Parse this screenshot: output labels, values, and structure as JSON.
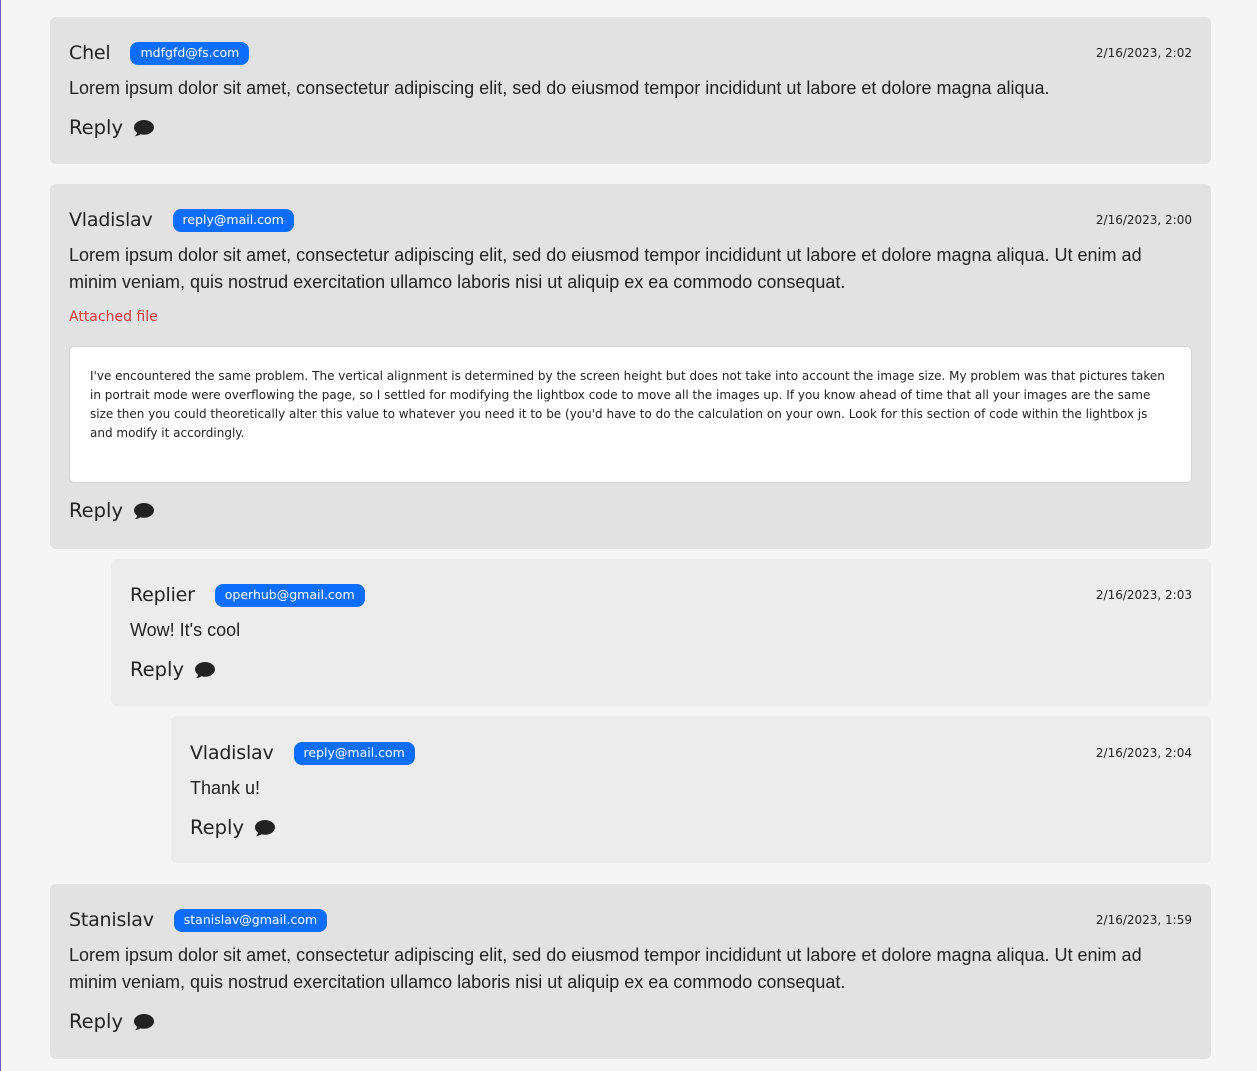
{
  "comments": [
    {
      "author": "Chel",
      "email": "mdfgfd@fs.com",
      "date": "2/16/2023, 2:02",
      "text": "Lorem ipsum dolor sit amet, consectetur adipiscing elit, sed do eiusmod tempor incididunt ut labore et dolore magna aliqua.",
      "reply_label": "Reply"
    },
    {
      "author": "Vladislav",
      "email": "reply@mail.com",
      "date": "2/16/2023, 2:00",
      "text": "Lorem ipsum dolor sit amet, consectetur adipiscing elit, sed do eiusmod tempor incididunt ut labore et dolore magna aliqua. Ut enim ad minim veniam, quis nostrud exercitation ullamco laboris nisi ut aliquip ex ea commodo consequat.",
      "attachment_label": "Attached file",
      "attachment_text": "I've encountered the same problem. The vertical alignment is determined by the screen height but does not take into account the image size. My problem was that pictures taken in portrait mode were overflowing the page, so I settled for modifying the lightbox code to move all the images up. If you know ahead of time that all your images are the same size then you could theoretically alter this value to whatever you need it to be (you'd have to do the calculation on your own. Look for this section of code within the lightbox js and modify it accordingly.",
      "reply_label": "Reply"
    },
    {
      "author": "Replier",
      "email": "operhub@gmail.com",
      "date": "2/16/2023, 2:03",
      "text": "Wow! It's cool",
      "reply_label": "Reply"
    },
    {
      "author": "Vladislav",
      "email": "reply@mail.com",
      "date": "2/16/2023, 2:04",
      "text": "Thank u!",
      "reply_label": "Reply"
    },
    {
      "author": "Stanislav",
      "email": "stanislav@gmail.com",
      "date": "2/16/2023, 1:59",
      "text": "Lorem ipsum dolor sit amet, consectetur adipiscing elit, sed do eiusmod tempor incididunt ut labore et dolore magna aliqua. Ut enim ad minim veniam, quis nostrud exercitation ullamco laboris nisi ut aliquip ex ea commodo consequat.",
      "reply_label": "Reply"
    }
  ],
  "icons": {
    "reply": "comment-icon"
  },
  "colors": {
    "badge": "#0d6efd",
    "attachment_link": "#d9363e",
    "card_top": "#e2e2e2",
    "card_nested": "#ececec"
  }
}
